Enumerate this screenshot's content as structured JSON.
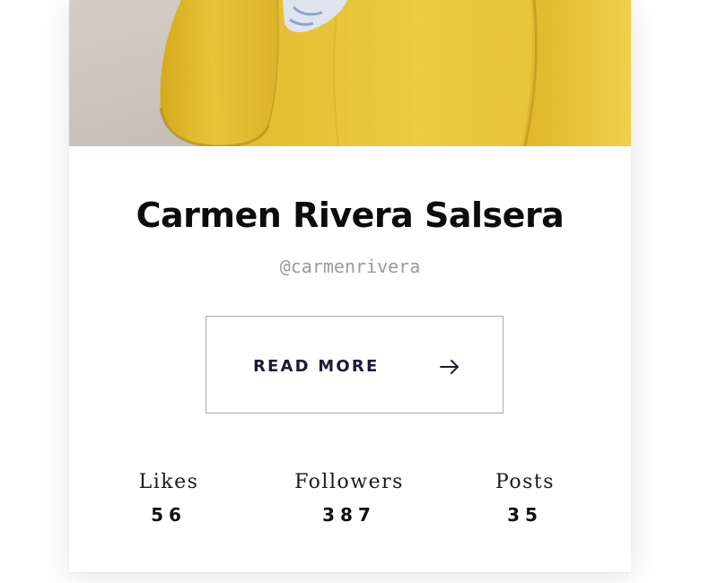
{
  "profile": {
    "name": "Carmen Rivera Salsera",
    "handle": "@carmenrivera"
  },
  "cover": {
    "icon": "yellow-sofa-photo",
    "colors": {
      "sofa": "#e8c53a",
      "floor": "#c9c2ba",
      "cushion": "#dfe6f2"
    }
  },
  "actions": {
    "read_more_label": "READ MORE",
    "read_more_icon": "arrow-right-icon"
  },
  "stats": [
    {
      "label": "Likes",
      "value": "56"
    },
    {
      "label": "Followers",
      "value": "387"
    },
    {
      "label": "Posts",
      "value": "35"
    }
  ],
  "colors": {
    "button_text": "#1c1a36",
    "button_border": "#a9a9a9",
    "handle": "#9a9a9a"
  }
}
